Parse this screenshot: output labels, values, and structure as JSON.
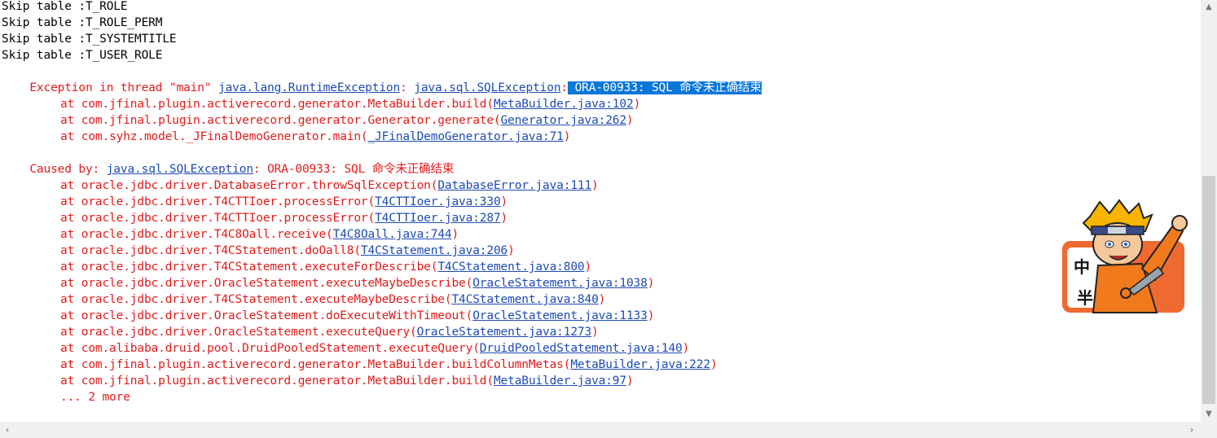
{
  "console": {
    "skip_lines": [
      "Skip table :T_ROLE",
      "Skip table :T_ROLE_PERM",
      "Skip table :T_SYSTEMTITLE",
      "Skip table :T_USER_ROLE"
    ],
    "exception": {
      "prefix": "Exception in thread \"main\" ",
      "exc1": "java.lang.RuntimeException",
      "sep1": ": ",
      "exc2": "java.sql.SQLException",
      "sep2": ":",
      "message": " ORA-00933: SQL 命令未正确结束"
    },
    "trace1": [
      {
        "method": "at com.jfinal.plugin.activerecord.generator.MetaBuilder.build(",
        "link": "MetaBuilder.java:102",
        "close": ")"
      },
      {
        "method": "at com.jfinal.plugin.activerecord.generator.Generator.generate(",
        "link": "Generator.java:262",
        "close": ")"
      },
      {
        "method": "at com.syhz.model._JFinalDemoGenerator.main(",
        "link": "_JFinalDemoGenerator.java:71",
        "close": ")"
      }
    ],
    "caused_by": {
      "prefix": "Caused by: ",
      "exc": "java.sql.SQLException",
      "message": ": ORA-00933: SQL 命令未正确结束"
    },
    "trace2": [
      {
        "method": "at oracle.jdbc.driver.DatabaseError.throwSqlException(",
        "link": "DatabaseError.java:111",
        "close": ")"
      },
      {
        "method": "at oracle.jdbc.driver.T4CTTIoer.processError(",
        "link": "T4CTTIoer.java:330",
        "close": ")"
      },
      {
        "method": "at oracle.jdbc.driver.T4CTTIoer.processError(",
        "link": "T4CTTIoer.java:287",
        "close": ")"
      },
      {
        "method": "at oracle.jdbc.driver.T4C8Oall.receive(",
        "link": "T4C8Oall.java:744",
        "close": ")"
      },
      {
        "method": "at oracle.jdbc.driver.T4CStatement.doOall8(",
        "link": "T4CStatement.java:206",
        "close": ")"
      },
      {
        "method": "at oracle.jdbc.driver.T4CStatement.executeForDescribe(",
        "link": "T4CStatement.java:800",
        "close": ")"
      },
      {
        "method": "at oracle.jdbc.driver.OracleStatement.executeMaybeDescribe(",
        "link": "OracleStatement.java:1038",
        "close": ")"
      },
      {
        "method": "at oracle.jdbc.driver.T4CStatement.executeMaybeDescribe(",
        "link": "T4CStatement.java:840",
        "close": ")"
      },
      {
        "method": "at oracle.jdbc.driver.OracleStatement.doExecuteWithTimeout(",
        "link": "OracleStatement.java:1133",
        "close": ")"
      },
      {
        "method": "at oracle.jdbc.driver.OracleStatement.executeQuery(",
        "link": "OracleStatement.java:1273",
        "close": ")"
      },
      {
        "method": "at com.alibaba.druid.pool.DruidPooledStatement.executeQuery(",
        "link": "DruidPooledStatement.java:140",
        "close": ")"
      },
      {
        "method": "at com.jfinal.plugin.activerecord.generator.MetaBuilder.buildColumnMetas(",
        "link": "MetaBuilder.java:222",
        "close": ")"
      },
      {
        "method": "at com.jfinal.plugin.activerecord.generator.MetaBuilder.build(",
        "link": "MetaBuilder.java:97",
        "close": ")"
      }
    ],
    "more": "... 2 more"
  },
  "sticker": {
    "char_top": "中",
    "char_bottom": "半",
    "icon": "ninja-character-sticker"
  },
  "scrollbars": {
    "up_arrow": "▲",
    "down_arrow": "▼",
    "left_arrow": "‹",
    "right_arrow": "›"
  },
  "colors": {
    "text": "#000000",
    "error": "#e11b1b",
    "link": "#1e4bb3",
    "selection": "#0a76d8",
    "sticker_orange": "#ef6a30"
  }
}
